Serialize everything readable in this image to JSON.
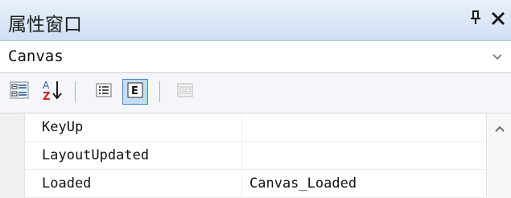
{
  "window": {
    "title": "属性窗口",
    "pin_glyph": "ꟷ",
    "close_glyph": "✕"
  },
  "selector": {
    "value": "Canvas"
  },
  "toolbar": {
    "buttons": [
      {
        "icon": "categorized-icon",
        "active": false
      },
      {
        "icon": "sort-alphabetical-icon",
        "active": false
      },
      {
        "icon": "properties-icon",
        "active": false
      },
      {
        "icon": "events-icon",
        "active": true,
        "glyph": "E"
      },
      {
        "icon": "property-pages-icon",
        "active": false,
        "disabled": true
      }
    ]
  },
  "properties": {
    "rows": [
      {
        "name": "KeyUp",
        "value": ""
      },
      {
        "name": "LayoutUpdated",
        "value": ""
      },
      {
        "name": "Loaded",
        "value": "Canvas_Loaded"
      }
    ]
  },
  "colors": {
    "title_gradient_top": "#e9f1fb",
    "title_gradient_bottom": "#cfdff3",
    "active_button_fill": "#c4dcf6",
    "active_button_border": "#3b86d6"
  }
}
